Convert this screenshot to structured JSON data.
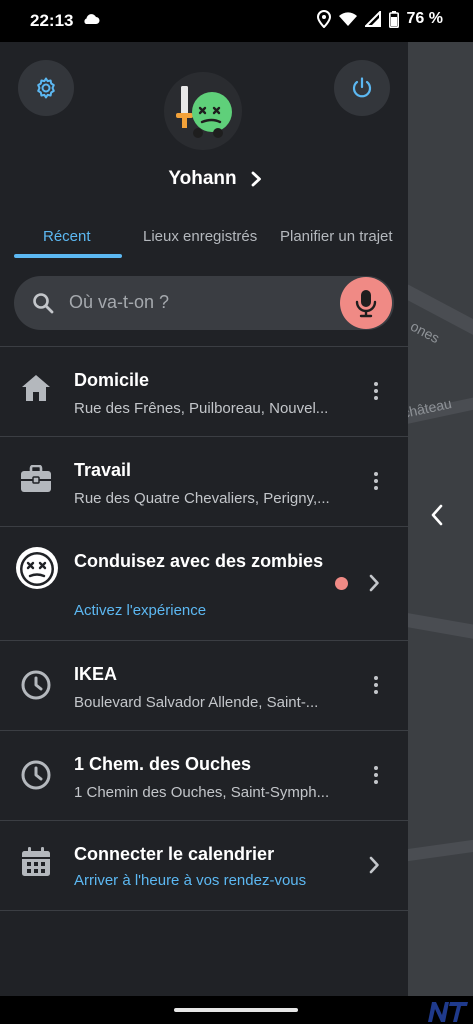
{
  "status": {
    "time": "22:13",
    "battery": "76 %"
  },
  "drawer": {
    "username": "Yohann",
    "tabs": [
      {
        "label": "Récent"
      },
      {
        "label": "Lieux enregistrés"
      },
      {
        "label": "Planifier un trajet"
      }
    ],
    "search": {
      "placeholder": "Où va-t-on ?"
    },
    "items": [
      {
        "title": "Domicile",
        "subtitle": "Rue des Frênes, Puilboreau, Nouvel...",
        "icon": "home-icon"
      },
      {
        "title": "Travail",
        "subtitle": "Rue des Quatre Chevaliers, Perigny,...",
        "icon": "briefcase-icon"
      },
      {
        "title": "Conduisez avec des zombies",
        "subtitle": "Activez l'expérience",
        "icon": "zombie-icon"
      },
      {
        "title": "IKEA",
        "subtitle": "Boulevard Salvador Allende, Saint-...",
        "icon": "clock-icon"
      },
      {
        "title": "1 Chem. des Ouches",
        "subtitle": "1 Chemin des Ouches, Saint-Symph...",
        "icon": "clock-icon"
      },
      {
        "title": "Connecter le calendrier",
        "subtitle": "Arriver à l'heure à vos rendez-vous",
        "icon": "calendar-icon"
      }
    ]
  },
  "map": {
    "labels": [
      "ones",
      "château"
    ]
  },
  "colors": {
    "accent": "#5cb8f2",
    "mic": "#f08a85",
    "drawer_bg": "#202226"
  }
}
